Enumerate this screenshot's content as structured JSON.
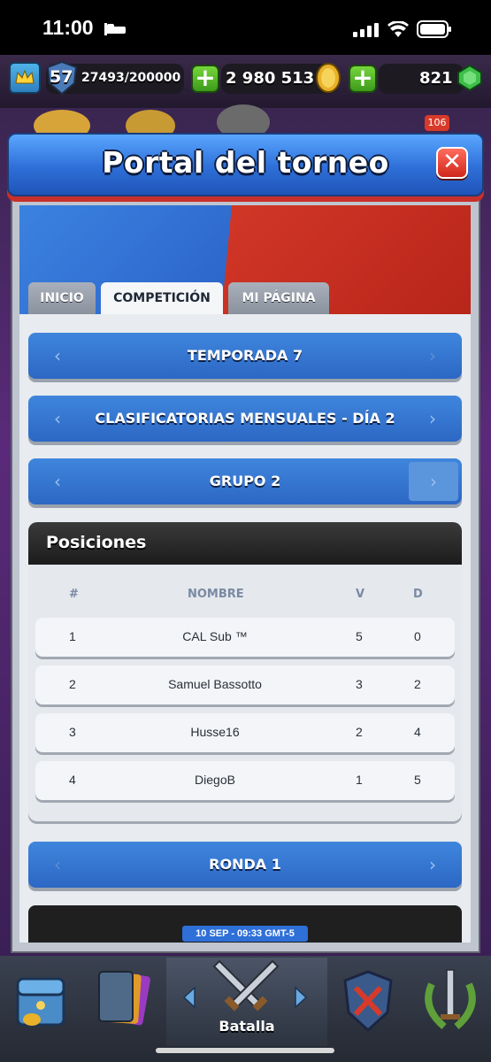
{
  "status_bar": {
    "time": "11:00"
  },
  "hud": {
    "level": "57",
    "xp": "27493/200000",
    "gold": "2 980 513",
    "gems": "821"
  },
  "modal": {
    "title": "Portal del torneo",
    "close": "✕"
  },
  "tabs": [
    {
      "label": "INICIO",
      "active": false
    },
    {
      "label": "COMPETICIÓN",
      "active": true
    },
    {
      "label": "MI PÁGINA",
      "active": false
    }
  ],
  "selectors": {
    "season": "TEMPORADA 7",
    "stage": "CLASIFICATORIAS MENSUALES - DÍA 2",
    "group": "GRUPO 2",
    "round": "RONDA 1"
  },
  "standings": {
    "title": "Posiciones",
    "columns": [
      "#",
      "NOMBRE",
      "V",
      "D"
    ],
    "rows": [
      {
        "rank": "1",
        "name": "CAL Sub ™",
        "wins": "5",
        "losses": "0"
      },
      {
        "rank": "2",
        "name": "Samuel Bassotto",
        "wins": "3",
        "losses": "2"
      },
      {
        "rank": "3",
        "name": "Husse16",
        "wins": "2",
        "losses": "4"
      },
      {
        "rank": "4",
        "name": "DiegoB",
        "wins": "1",
        "losses": "5"
      }
    ]
  },
  "match": {
    "date": "10 SEP - 09:33 GMT-5"
  },
  "nav": {
    "battle_label": "Batalla"
  },
  "colors": {
    "accent_blue": "#2e6fd8",
    "accent_red": "#d23727",
    "plus_green": "#5bbf2a"
  }
}
